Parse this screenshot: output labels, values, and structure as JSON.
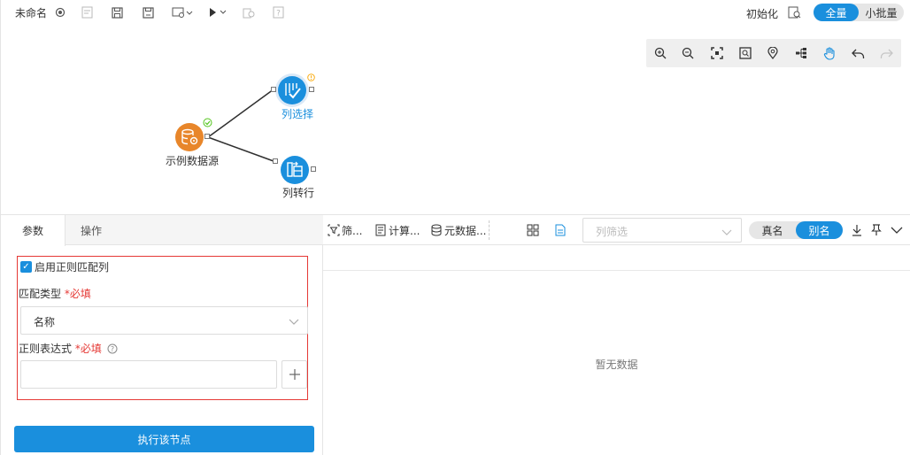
{
  "toolbar": {
    "title": "未命名",
    "init_label": "初始化",
    "mode_options": [
      "全量",
      "小批量"
    ],
    "mode_selected": "全量",
    "icons": [
      "settings-icon",
      "properties-icon",
      "save-icon",
      "save-as-icon",
      "preview-icon",
      "run-icon",
      "copy-icon",
      "help-icon",
      "init-icon"
    ]
  },
  "zoom_bar": {
    "icons": [
      "zoom-in-icon",
      "zoom-out-icon",
      "fit-screen-icon",
      "actual-size-icon",
      "locate-icon",
      "layout-icon",
      "pan-icon",
      "undo-icon",
      "redo-icon"
    ]
  },
  "flow": {
    "nodes": [
      {
        "label": "示例数据源",
        "icon": "database-gear-icon",
        "color": "#e8862a",
        "status": "success"
      },
      {
        "label": "列选择",
        "icon": "column-select-icon",
        "color": "#1a8fdd",
        "status": "warning"
      },
      {
        "label": "列转行",
        "icon": "column-to-row-icon",
        "color": "#1a8fdd",
        "status": "none"
      }
    ]
  },
  "left_panel": {
    "tabs": [
      "参数",
      "操作"
    ],
    "active_tab": "参数",
    "enable_regex_label": "启用正则匹配列",
    "match_type_label": "匹配类型",
    "required_text": "*必填",
    "match_type_value": "名称",
    "regex_label": "正则表达式",
    "regex_value": "",
    "execute_label": "执行该节点"
  },
  "right_panel": {
    "toolbar": {
      "filter_label": "筛...",
      "compute_label": "计算...",
      "metadata_label": "元数据...",
      "column_filter_placeholder": "列筛选",
      "name_options": [
        "真名",
        "别名"
      ],
      "name_selected": "别名"
    },
    "empty_text": "暂无数据"
  },
  "colors": {
    "accent": "#1a8fdd",
    "source_node": "#e8862a",
    "success": "#52c41a",
    "warning": "#faad14",
    "error_border": "#e53935"
  }
}
